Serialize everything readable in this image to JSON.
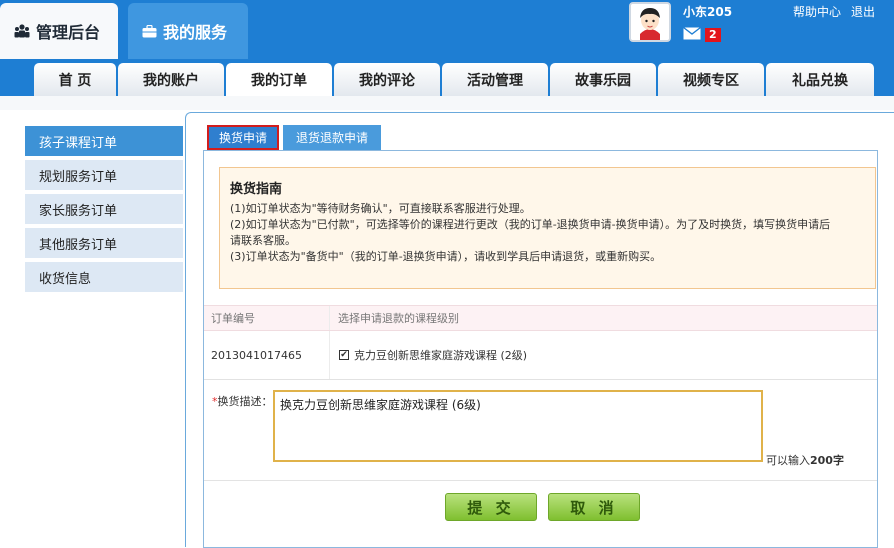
{
  "header": {
    "tab_admin": "管理后台",
    "tab_service": "我的服务",
    "user_name": "小东205",
    "unread_count": "2",
    "help_link": "帮助中心",
    "logout_link": "退出"
  },
  "nav": {
    "items": [
      {
        "label": "首 页"
      },
      {
        "label": "我的账户"
      },
      {
        "label": "我的订单"
      },
      {
        "label": "我的评论"
      },
      {
        "label": "活动管理"
      },
      {
        "label": "故事乐园"
      },
      {
        "label": "视频专区"
      },
      {
        "label": "礼品兑换"
      }
    ],
    "active": "我的订单"
  },
  "sidebar": {
    "items": [
      {
        "label": "孩子课程订单"
      },
      {
        "label": "规划服务订单"
      },
      {
        "label": "家长服务订单"
      },
      {
        "label": "其他服务订单"
      },
      {
        "label": "收货信息"
      }
    ]
  },
  "subtabs": {
    "exchange": "换货申请",
    "refund": "退货退款申请"
  },
  "guide": {
    "title": "换货指南",
    "lines": [
      "(1)如订单状态为\"等待财务确认\"，可直接联系客服进行处理。",
      "(2)如订单状态为\"已付款\"，可选择等价的课程进行更改（我的订单-退换货申请-换货申请）。为了及时换货，填写换货申请后",
      "请联系客服。",
      "(3)订单状态为\"备货中\"（我的订单-退换货申请），请收到学具后申请退货，或重新购买。"
    ]
  },
  "table": {
    "headers": [
      "订单编号",
      "选择申请退款的课程级别"
    ],
    "order_no": "2013041017465",
    "course": "克力豆创新思维家庭游戏课程 (2级)",
    "course_checked": true
  },
  "form": {
    "required_mark": "*",
    "desc_label": "换货描述：",
    "desc_value": "换克力豆创新思维家庭游戏课程 (6级)",
    "counter_prefix": "可以输入",
    "counter_value": "200字"
  },
  "buttons": {
    "submit": "提 交",
    "cancel": "取 消"
  },
  "colors": {
    "header_blue": "#1e7ed3",
    "active_side": "#3d92d6",
    "button_green": "#7fbf2f",
    "highlight_red": "#d21d1d"
  }
}
